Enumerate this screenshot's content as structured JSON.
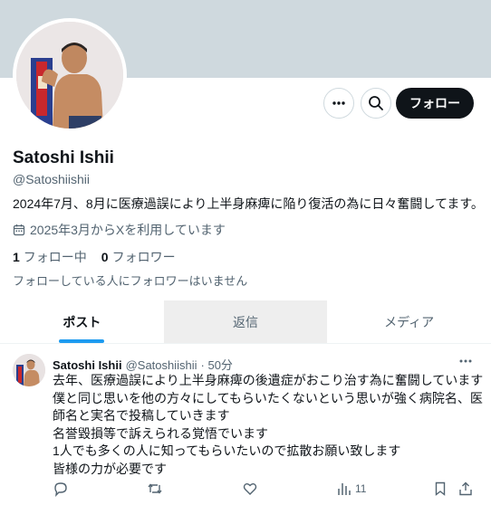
{
  "profile": {
    "name": "Satoshi Ishii",
    "handle": "@Satoshiishii",
    "bio": "2024年7月、8月に医療過誤により上半身麻痺に陥り復活の為に日々奮闘してます。",
    "joined": "2025年3月からXを利用しています",
    "following_count": "1",
    "following_label": "フォロー中",
    "followers_count": "0",
    "followers_label": "フォロワー",
    "followers_note": "フォローしている人にフォロワーはいません"
  },
  "header_actions": {
    "more_icon": "more-icon",
    "search_icon": "search-icon",
    "follow_label": "フォロー"
  },
  "tabs": [
    {
      "label": "ポスト",
      "active": true
    },
    {
      "label": "返信",
      "active": false
    },
    {
      "label": "メディア",
      "active": false
    }
  ],
  "post": {
    "author_name": "Satoshi Ishii",
    "author_handle": "@Satoshiishii",
    "time": "· 50分",
    "lines": [
      "去年、医療過誤により上半身麻痺の後遺症がおこり治す為に奮闘しています",
      "僕と同じ思いを他の方々にしてもらいたくないという思いが強く病院名、医",
      "師名と実名で投稿していきます",
      "名誉毀損等で訴えられる覚悟でいます",
      "1人でも多くの人に知ってもらいたいので拡散お願い致します",
      "皆様の力が必要です"
    ],
    "views": "11"
  },
  "colors": {
    "banner": "#cfd9de",
    "accent": "#1d9bf0",
    "text": "#0f1419",
    "muted": "#536471"
  }
}
